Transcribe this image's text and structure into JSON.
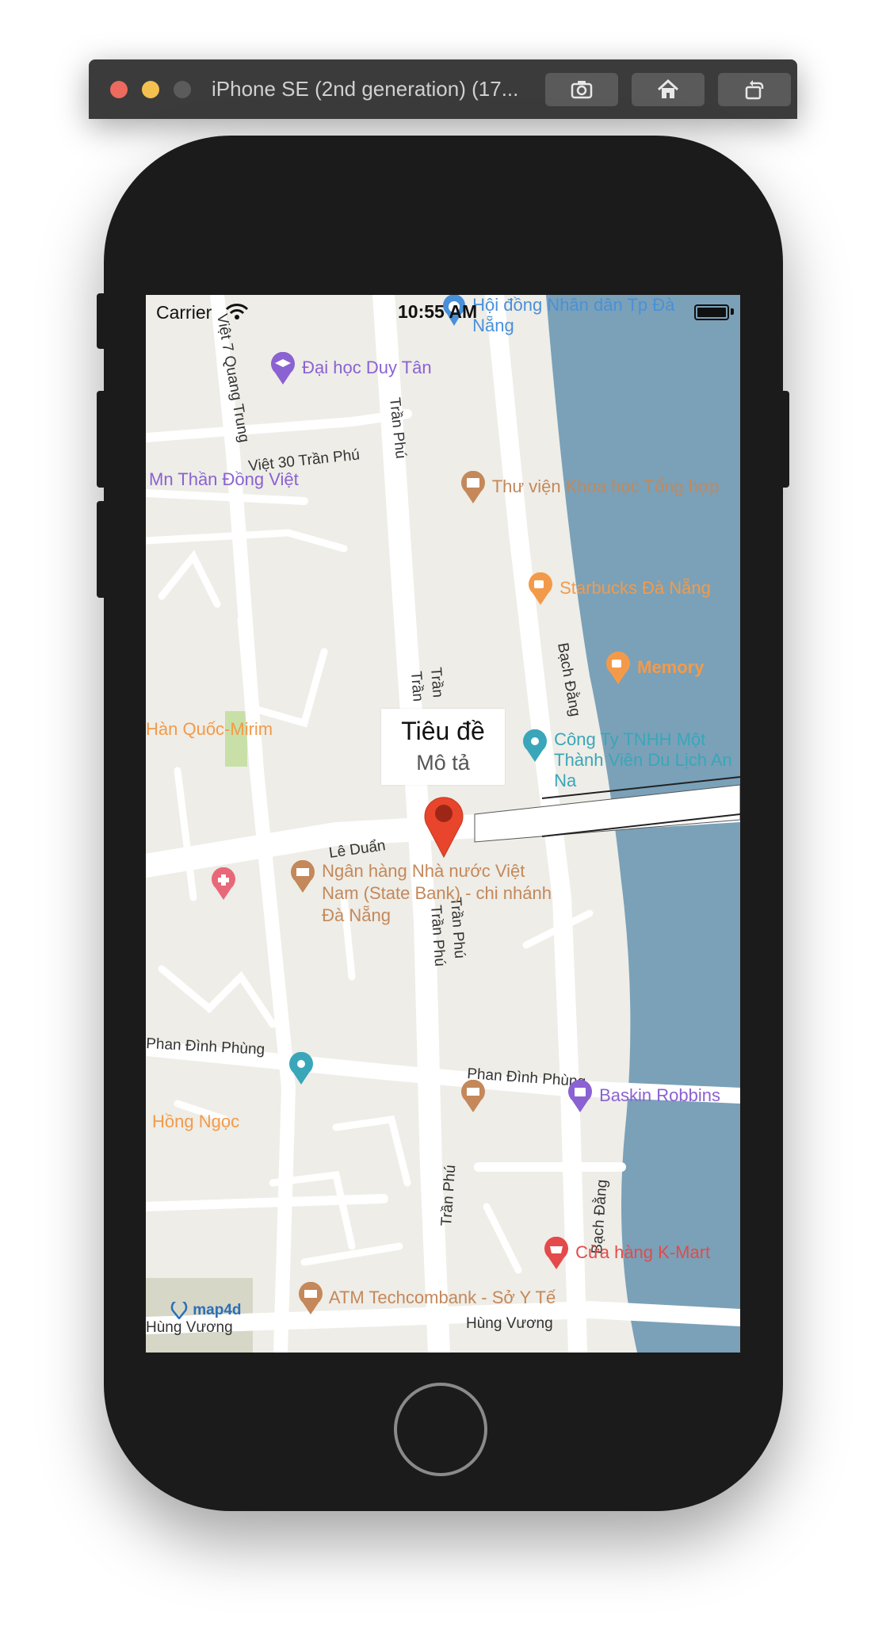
{
  "window": {
    "title": "iPhone SE (2nd generation) (17..."
  },
  "status_bar": {
    "carrier": "Carrier",
    "time": "10:55 AM"
  },
  "map": {
    "streets": [
      "Việt 7 Quang Trung",
      "Trần Phú",
      "Việt 30 Trần Phú",
      "Trần",
      "Trần",
      "Bạch Đằng",
      "Lê Duẩn",
      "Trần Phú",
      "Trần Phú",
      "Phan Đình Phùng",
      "Phan Đình Phùng",
      "Trần Phú",
      "Bạch Đằng",
      "Hùng Vương",
      "Hùng Vương"
    ],
    "pois": [
      {
        "label": "Hội đồng Nhân dân Tp Đà Nẵng",
        "color": "#4a90d9",
        "icon": "government-icon"
      },
      {
        "label": "Đại học Duy Tân",
        "color": "#8a62d2",
        "icon": "education-icon"
      },
      {
        "label": "Mn Thần Đồng Việt",
        "color": "#8a62d2",
        "icon": "school-icon"
      },
      {
        "label": "Thư viện Khoa học Tổng hợp",
        "color": "#c4885a",
        "icon": "library-icon"
      },
      {
        "label": "Starbucks Đà Nẵng",
        "color": "#f39a4a",
        "icon": "cafe-icon"
      },
      {
        "label": "Memory",
        "color": "#f39a4a",
        "icon": "cafe-icon"
      },
      {
        "label": "Hàn Quốc-Mirim",
        "color": "#f39a4a",
        "icon": "restaurant-icon"
      },
      {
        "label": "Công Ty TNHH Một Thành Viên Du Lịch An Na",
        "color": "#3aa6b9",
        "icon": "place-icon"
      },
      {
        "label": "Ngân hàng Nhà nước Việt Nam (State Bank) - chi nhánh Đà Nẵng",
        "color": "#c4885a",
        "icon": "bank-icon"
      },
      {
        "label": "Hồng Ngọc",
        "color": "#f39a4a",
        "icon": "restaurant-icon"
      },
      {
        "label": "Baskin Robbins",
        "color": "#8a62d2",
        "icon": "shop-icon"
      },
      {
        "label": "Cửa hàng K-Mart",
        "color": "#e44a4a",
        "icon": "basket-icon"
      },
      {
        "label": "ATM Techcombank - Sở Y Tế",
        "color": "#c4885a",
        "icon": "atm-icon"
      }
    ],
    "callout": {
      "title": "Tiêu đề",
      "subtitle": "Mô tả"
    },
    "attribution": "map4d",
    "colors": {
      "land": "#eeede7",
      "road": "#ffffff",
      "water": "#7aa1b8",
      "park": "#c8e0a8",
      "marker": "#e8452c"
    }
  }
}
